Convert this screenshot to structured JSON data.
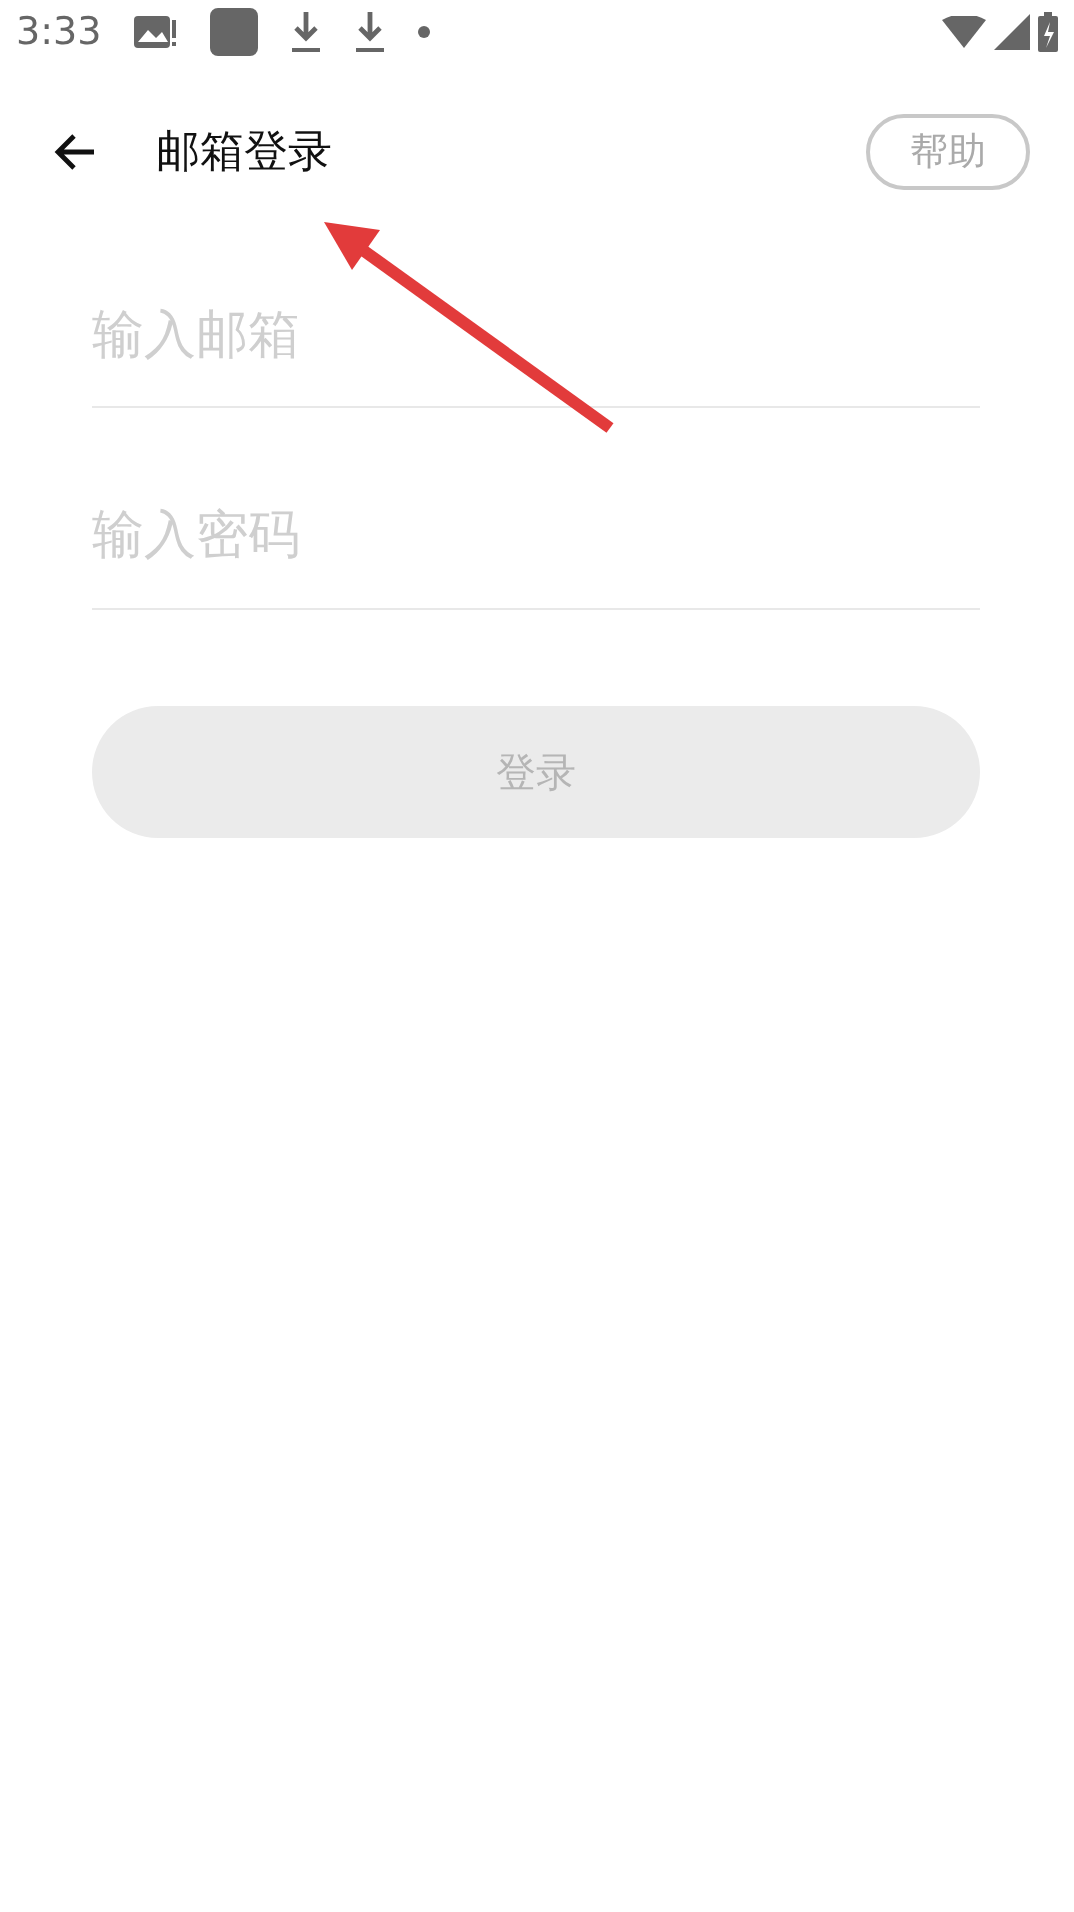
{
  "status_bar": {
    "time": "3:33"
  },
  "header": {
    "title": "邮箱登录",
    "help_button": "帮助"
  },
  "fields": [
    {
      "placeholder": "输入邮箱"
    },
    {
      "placeholder": "输入密码"
    }
  ],
  "login_button": {
    "label": "登录",
    "disabled": true
  },
  "annotation": {
    "kind": "arrow"
  }
}
